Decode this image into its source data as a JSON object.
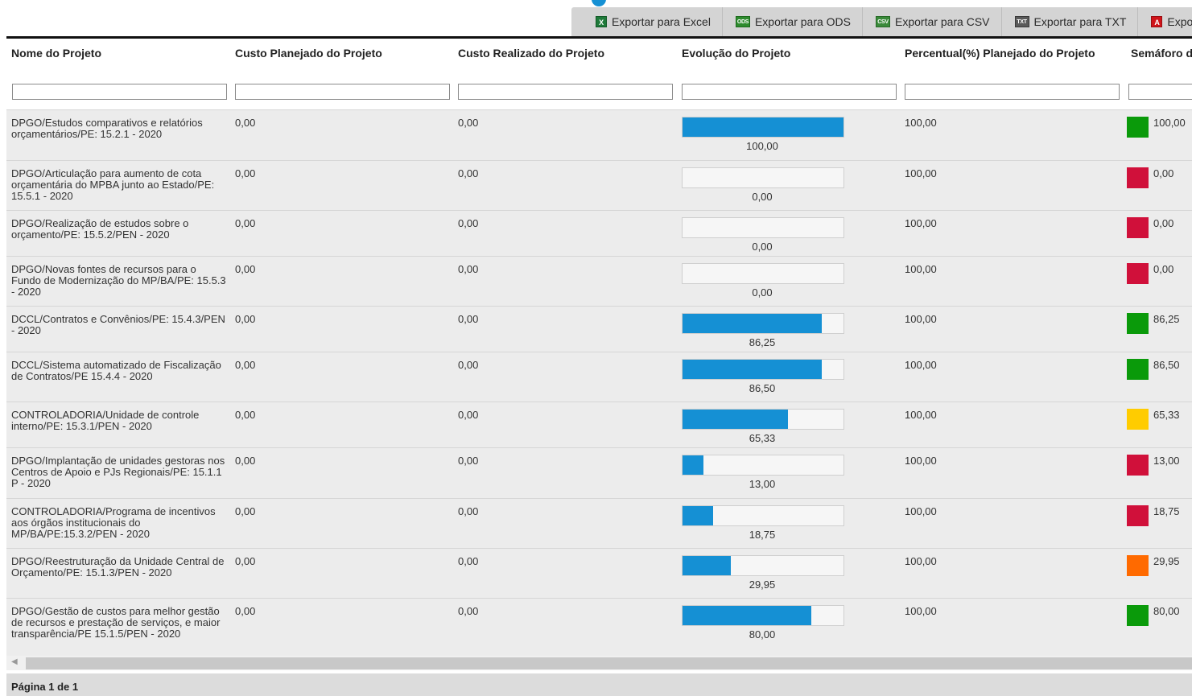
{
  "toolbar": {
    "buttons": [
      {
        "label": "Exportar para Excel",
        "icon": "excel-icon",
        "icon_text": "X"
      },
      {
        "label": "Exportar para ODS",
        "icon": "ods-icon",
        "icon_text": "ODS"
      },
      {
        "label": "Exportar para CSV",
        "icon": "csv-icon",
        "icon_text": "CSV"
      },
      {
        "label": "Exportar para TXT",
        "icon": "txt-icon",
        "icon_text": "TXT"
      },
      {
        "label": "Exportar para PDF",
        "icon": "pdf-icon",
        "icon_text": "A"
      }
    ]
  },
  "columns": [
    "Nome do Projeto",
    "Custo Planejado do Projeto",
    "Custo Realizado do Projeto",
    "Evolução do Projeto",
    "Percentual(%) Planejado do Projeto",
    "Semáforo do Projeto"
  ],
  "colors": {
    "bar_fill": "#1590d4",
    "green": "#0a9a0a",
    "red": "#d0103a",
    "yellow": "#ffcc00",
    "orange": "#ff6a00"
  },
  "rows": [
    {
      "name": "DPGO/Estudos comparativos e relatórios orçamentários/PE: 15.2.1 - 2020",
      "planned_cost": "0,00",
      "realized_cost": "0,00",
      "evolution": 100.0,
      "evolution_label": "100,00",
      "planned_pct": "100,00",
      "semaphore_color": "green",
      "semaphore_value": "100,00"
    },
    {
      "name": "DPGO/Articulação para aumento de cota orçamentária do MPBA junto ao Estado/PE: 15.5.1 - 2020",
      "planned_cost": "0,00",
      "realized_cost": "0,00",
      "evolution": 0.0,
      "evolution_label": "0,00",
      "planned_pct": "100,00",
      "semaphore_color": "red",
      "semaphore_value": "0,00"
    },
    {
      "name": "DPGO/Realização de estudos sobre o orçamento/PE: 15.5.2/PEN - 2020",
      "planned_cost": "0,00",
      "realized_cost": "0,00",
      "evolution": 0.0,
      "evolution_label": "0,00",
      "planned_pct": "100,00",
      "semaphore_color": "red",
      "semaphore_value": "0,00"
    },
    {
      "name": "DPGO/Novas fontes de recursos para o Fundo de Modernização do MP/BA/PE: 15.5.3 - 2020",
      "planned_cost": "0,00",
      "realized_cost": "0,00",
      "evolution": 0.0,
      "evolution_label": "0,00",
      "planned_pct": "100,00",
      "semaphore_color": "red",
      "semaphore_value": "0,00"
    },
    {
      "name": "DCCL/Contratos e Convênios/PE: 15.4.3/PEN - 2020",
      "planned_cost": "0,00",
      "realized_cost": "0,00",
      "evolution": 86.25,
      "evolution_label": "86,25",
      "planned_pct": "100,00",
      "semaphore_color": "green",
      "semaphore_value": "86,25"
    },
    {
      "name": "DCCL/Sistema automatizado de Fiscalização de Contratos/PE 15.4.4 - 2020",
      "planned_cost": "0,00",
      "realized_cost": "0,00",
      "evolution": 86.5,
      "evolution_label": "86,50",
      "planned_pct": "100,00",
      "semaphore_color": "green",
      "semaphore_value": "86,50"
    },
    {
      "name": "CONTROLADORIA/Unidade de controle interno/PE: 15.3.1/PEN - 2020",
      "planned_cost": "0,00",
      "realized_cost": "0,00",
      "evolution": 65.33,
      "evolution_label": "65,33",
      "planned_pct": "100,00",
      "semaphore_color": "yellow",
      "semaphore_value": "65,33"
    },
    {
      "name": "DPGO/Implantação de unidades gestoras nos Centros de Apoio e PJs Regionais/PE: 15.1.1 P - 2020",
      "planned_cost": "0,00",
      "realized_cost": "0,00",
      "evolution": 13.0,
      "evolution_label": "13,00",
      "planned_pct": "100,00",
      "semaphore_color": "red",
      "semaphore_value": "13,00"
    },
    {
      "name": "CONTROLADORIA/Programa de incentivos aos órgãos institucionais do MP/BA/PE:15.3.2/PEN - 2020",
      "planned_cost": "0,00",
      "realized_cost": "0,00",
      "evolution": 18.75,
      "evolution_label": "18,75",
      "planned_pct": "100,00",
      "semaphore_color": "red",
      "semaphore_value": "18,75"
    },
    {
      "name": "DPGO/Reestruturação da Unidade Central de Orçamento/PE: 15.1.3/PEN - 2020",
      "planned_cost": "0,00",
      "realized_cost": "0,00",
      "evolution": 29.95,
      "evolution_label": "29,95",
      "planned_pct": "100,00",
      "semaphore_color": "orange",
      "semaphore_value": "29,95"
    },
    {
      "name": "DPGO/Gestão de custos para melhor gestão de recursos e prestação de serviços, e maior transparência/PE 15.1.5/PEN - 2020",
      "planned_cost": "0,00",
      "realized_cost": "0,00",
      "evolution": 80.0,
      "evolution_label": "80,00",
      "planned_pct": "100,00",
      "semaphore_color": "green",
      "semaphore_value": "80,00"
    }
  ],
  "pager": {
    "label": "Página 1 de 1"
  }
}
